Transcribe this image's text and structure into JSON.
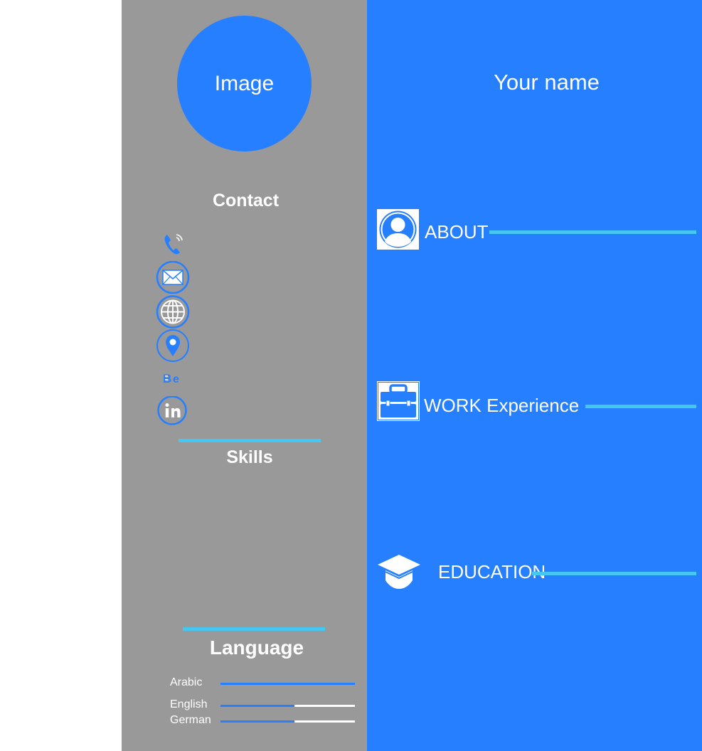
{
  "sidebar": {
    "photo_label": "Image",
    "contact_title": "Contact",
    "contact_icons": [
      "phone-icon",
      "email-icon",
      "globe-icon",
      "location-icon",
      "behance-icon",
      "linkedin-icon"
    ],
    "skills_title": "Skills",
    "language_title": "Language",
    "languages": [
      {
        "label": "Arabic",
        "level": 1.0
      },
      {
        "label": "English",
        "level": 0.55
      },
      {
        "label": "German",
        "level": 0.55
      }
    ]
  },
  "main": {
    "name": "Your name",
    "sections": [
      {
        "label": "ABOUT",
        "icon": "user-profile-icon"
      },
      {
        "label": "WORK Experience",
        "icon": "briefcase-icon"
      },
      {
        "label": "EDUCATION",
        "icon": "graduation-cap-icon"
      }
    ]
  },
  "colors": {
    "sidebar_bg": "#999999",
    "main_bg": "#267fff",
    "accent_blue": "#267fff",
    "cyan_rule": "#45c7f2",
    "text": "#ffffff"
  }
}
